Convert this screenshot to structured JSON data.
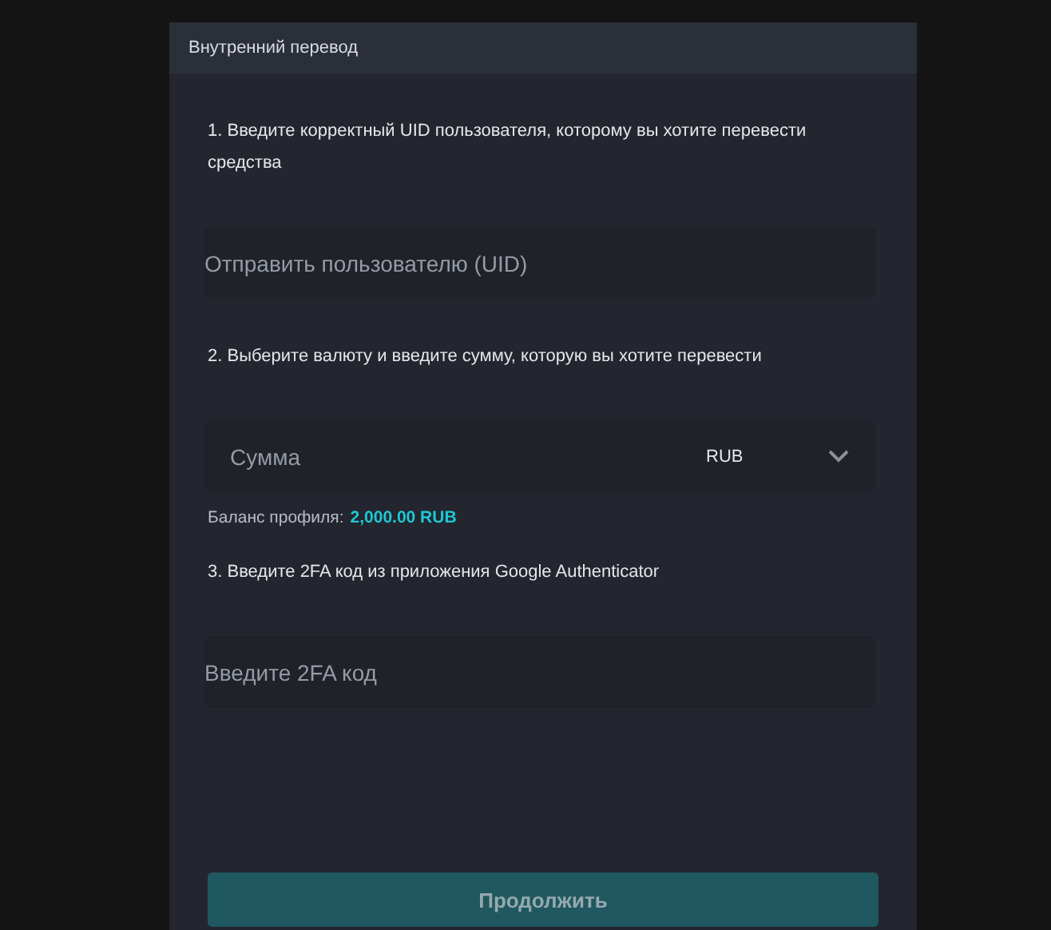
{
  "panel": {
    "title": "Внутренний перевод"
  },
  "steps": [
    {
      "instruction": "1. Введите корректный UID пользователя, которому вы хотите перевести средства",
      "field": {
        "kind": "text",
        "placeholder": "Отправить пользователю (UID)"
      }
    },
    {
      "instruction": "2. Выберите валюту и введите сумму, которую вы хотите перевести",
      "field": {
        "kind": "amount",
        "placeholder": "Сумма",
        "currency": "RUB"
      },
      "balance": {
        "label": "Баланс профиля:",
        "value": "2,000.00 RUB"
      }
    },
    {
      "instruction": "3. Введите 2FA код из приложения Google Authenticator",
      "field": {
        "kind": "text",
        "placeholder": "Введите 2FA код"
      }
    }
  ],
  "submit": {
    "label": "Продолжить",
    "disabled": true
  }
}
